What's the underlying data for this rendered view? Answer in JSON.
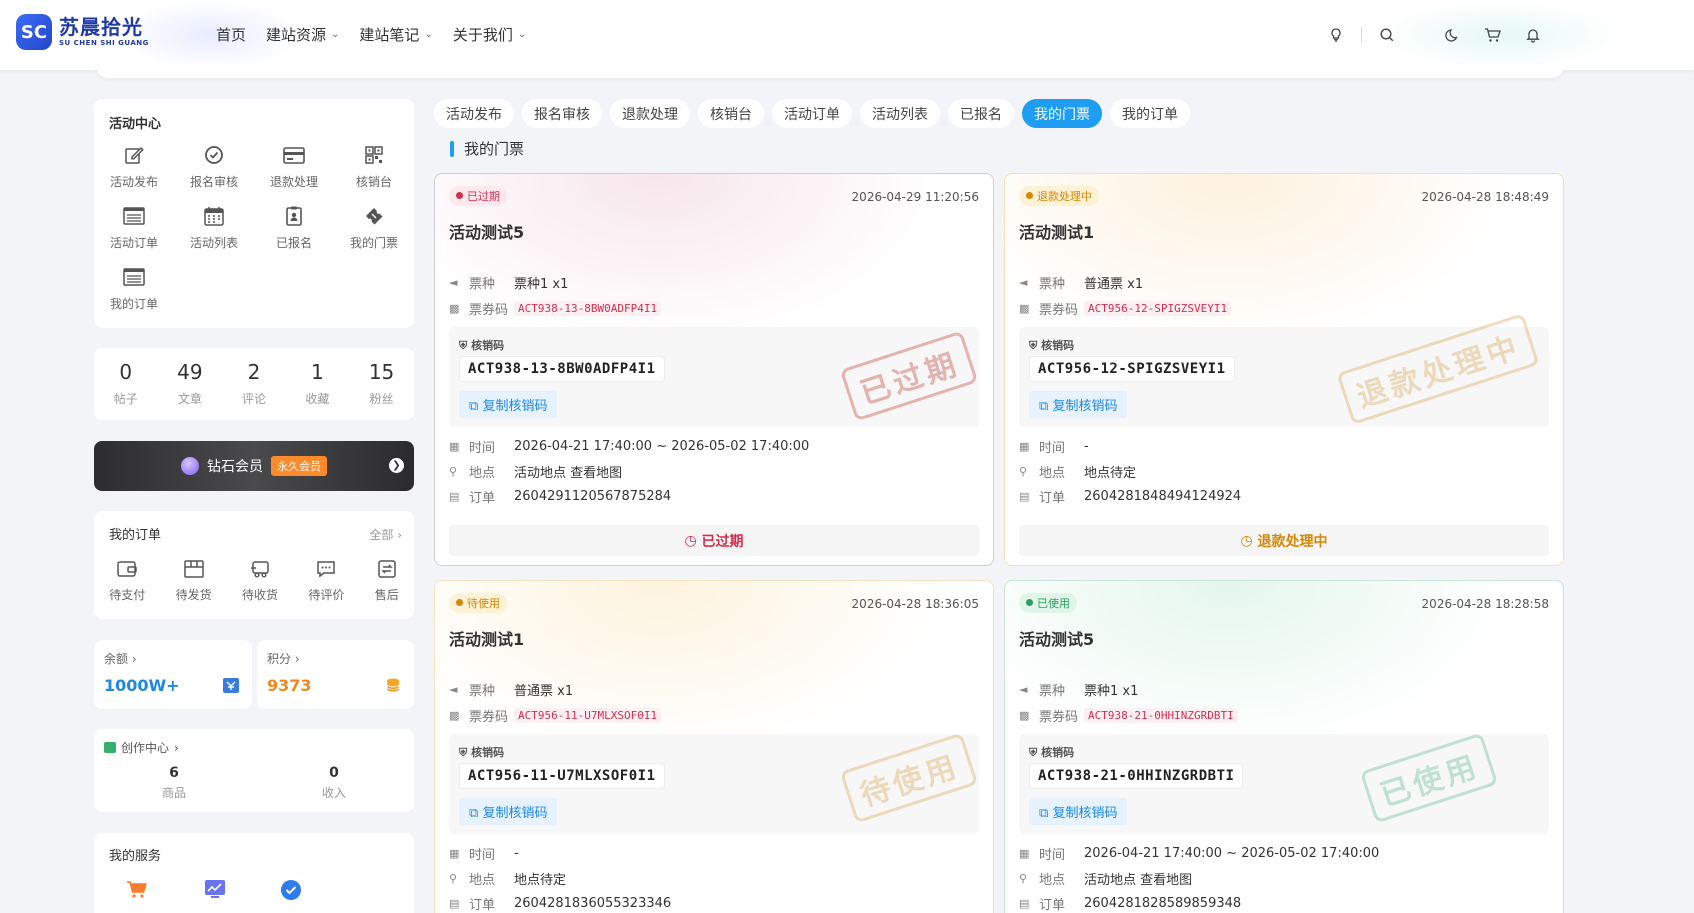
{
  "header": {
    "logo_mark": "SC",
    "logo_cn": "苏晨拾光",
    "logo_en": "SU CHEN SHI GUANG",
    "nav": [
      {
        "label": "首页",
        "dropdown": false
      },
      {
        "label": "建站资源",
        "dropdown": true
      },
      {
        "label": "建站笔记",
        "dropdown": true
      },
      {
        "label": "关于我们",
        "dropdown": true
      }
    ],
    "tools": [
      "lightbulb-icon",
      "search-icon",
      "moon-icon",
      "cart-icon",
      "bell-icon"
    ]
  },
  "activity_center": {
    "title": "活动中心",
    "items": [
      {
        "label": "活动发布",
        "icon": "edit-icon"
      },
      {
        "label": "报名审核",
        "icon": "check-circle-icon"
      },
      {
        "label": "退款处理",
        "icon": "card-icon"
      },
      {
        "label": "核销台",
        "icon": "qrcode-icon"
      },
      {
        "label": "活动订单",
        "icon": "list-icon"
      },
      {
        "label": "活动列表",
        "icon": "calendar-icon"
      },
      {
        "label": "已报名",
        "icon": "clipboard-icon"
      },
      {
        "label": "我的门票",
        "icon": "ticket-icon"
      },
      {
        "label": "我的订单",
        "icon": "list-icon"
      }
    ]
  },
  "stats": [
    {
      "num": "0",
      "label": "帖子"
    },
    {
      "num": "49",
      "label": "文章"
    },
    {
      "num": "2",
      "label": "评论"
    },
    {
      "num": "1",
      "label": "收藏"
    },
    {
      "num": "15",
      "label": "粉丝"
    }
  ],
  "vip": {
    "label": "钻石会员",
    "badge": "永久会员"
  },
  "my_orders": {
    "title": "我的订单",
    "all": "全部",
    "items": [
      {
        "label": "待支付",
        "icon": "wallet-icon"
      },
      {
        "label": "待发货",
        "icon": "box-icon"
      },
      {
        "label": "待收货",
        "icon": "truck-icon"
      },
      {
        "label": "待评价",
        "icon": "comment-icon"
      },
      {
        "label": "售后",
        "icon": "return-icon"
      }
    ]
  },
  "balance": {
    "label": "余额",
    "value": "1000W+"
  },
  "points": {
    "label": "积分",
    "value": "9373"
  },
  "creator": {
    "title": "创作中心",
    "items": [
      {
        "num": "6",
        "label": "商品"
      },
      {
        "num": "0",
        "label": "收入"
      }
    ]
  },
  "services": {
    "title": "我的服务",
    "icons": [
      "shopping-cart-icon",
      "chart-icon",
      "verified-icon"
    ]
  },
  "tabs": [
    {
      "label": "活动发布",
      "active": false
    },
    {
      "label": "报名审核",
      "active": false
    },
    {
      "label": "退款处理",
      "active": false
    },
    {
      "label": "核销台",
      "active": false
    },
    {
      "label": "活动订单",
      "active": false
    },
    {
      "label": "活动列表",
      "active": false
    },
    {
      "label": "已报名",
      "active": false
    },
    {
      "label": "我的门票",
      "active": true
    },
    {
      "label": "我的订单",
      "active": false
    }
  ],
  "section_title": "我的门票",
  "labels": {
    "ticket_type": "票种",
    "ticket_code": "票券码",
    "verify_code": "核销码",
    "copy": "复制核销码",
    "time": "时间",
    "place": "地点",
    "order": "订单"
  },
  "tickets": [
    {
      "status": "已过期",
      "status_color": "#d03050",
      "created": "2026-04-29 11:20:56",
      "title": "活动测试5",
      "ticket_type": "票种1 x1",
      "code": "ACT938-13-8BW0ADFP4I1",
      "time": "2026-04-21 17:40:00 ~ 2026-05-02 17:40:00",
      "place": "活动地点 查看地图",
      "order": "2604291120567875284",
      "stamp": "已过期",
      "footer": "已过期"
    },
    {
      "status": "退款处理中",
      "status_color": "#d48806",
      "created": "2026-04-28 18:48:49",
      "title": "活动测试1",
      "ticket_type": "普通票 x1",
      "code": "ACT956-12-SPIGZSVEYI1",
      "time": "-",
      "place": "地点待定",
      "order": "2604281848494124924",
      "stamp": "退款处理中",
      "footer": "退款处理中"
    },
    {
      "status": "待使用",
      "status_color": "#d48806",
      "created": "2026-04-28 18:36:05",
      "title": "活动测试1",
      "ticket_type": "普通票 x1",
      "code": "ACT956-11-U7MLXSOF0I1",
      "time": "-",
      "place": "地点待定",
      "order": "2604281836055323346",
      "stamp": "待使用",
      "footer": ""
    },
    {
      "status": "已使用",
      "status_color": "#2f9e63",
      "created": "2026-04-28 18:28:58",
      "title": "活动测试5",
      "ticket_type": "票种1 x1",
      "code": "ACT938-21-0HHINZGRDBTI",
      "time": "2026-04-21 17:40:00 ~ 2026-05-02 17:40:00",
      "place": "活动地点 查看地图",
      "order": "2604281828589859348",
      "stamp": "已使用",
      "footer": ""
    }
  ]
}
